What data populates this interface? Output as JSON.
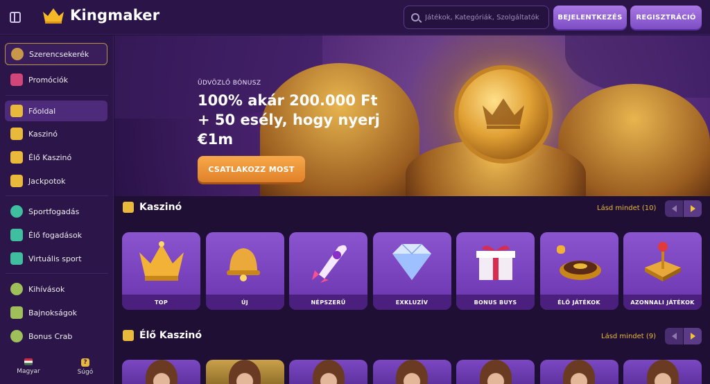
{
  "header": {
    "brand": "Kingmaker",
    "search_placeholder": "Játékok, Kategóriák, Szolgáltatók",
    "login_label": "BEJELENTKEZÉS",
    "register_label": "REGISZTRÁCIÓ"
  },
  "sidebar": {
    "items": [
      {
        "label": "Szerencsekerék",
        "icon": "wheel-icon"
      },
      {
        "label": "Promóciók",
        "icon": "gift-icon"
      },
      {
        "label": "Főoldal",
        "icon": "home-icon"
      },
      {
        "label": "Kaszinó",
        "icon": "slot-icon"
      },
      {
        "label": "Élő Kaszinó",
        "icon": "cards-icon"
      },
      {
        "label": "Jackpotok",
        "icon": "jackpot-icon"
      },
      {
        "label": "Sportfogadás",
        "icon": "ball-icon"
      },
      {
        "label": "Élő fogadások",
        "icon": "play-icon"
      },
      {
        "label": "Virtuális sport",
        "icon": "gamepad-icon"
      },
      {
        "label": "Kihívások",
        "icon": "badge-icon"
      },
      {
        "label": "Bajnokságok",
        "icon": "trophy-icon"
      },
      {
        "label": "Bonus Crab",
        "icon": "crab-icon"
      }
    ],
    "language_label": "Magyar",
    "help_label": "Súgó"
  },
  "hero": {
    "eyebrow": "ÜDVÖZLŐ BÓNUSZ",
    "title": "100% akár 200.000 Ft + 50 esély, hogy nyerj €1m",
    "cta_label": "CSATLAKOZZ MOST"
  },
  "casino": {
    "title": "Kaszinó",
    "see_all": "Lásd mindet (10)",
    "tiles": [
      {
        "label": "TOP",
        "icon": "crown-icon"
      },
      {
        "label": "ÚJ",
        "icon": "bell-icon"
      },
      {
        "label": "NÉPSZERŰ",
        "icon": "rocket-icon"
      },
      {
        "label": "EXKLUZÍV",
        "icon": "diamond-icon"
      },
      {
        "label": "BONUS BUYS",
        "icon": "giftbox-icon"
      },
      {
        "label": "ÉLŐ JÁTÉKOK",
        "icon": "roulette-icon"
      },
      {
        "label": "AZONNALI JÁTÉKOK",
        "icon": "joystick-icon"
      }
    ]
  },
  "live_casino": {
    "title": "Élő Kaszinó",
    "see_all": "Lásd mindet (9)"
  },
  "colors": {
    "accent_gold": "#e8b93b",
    "cta_orange": "#f0962e",
    "button_purple": "#9466d6"
  }
}
